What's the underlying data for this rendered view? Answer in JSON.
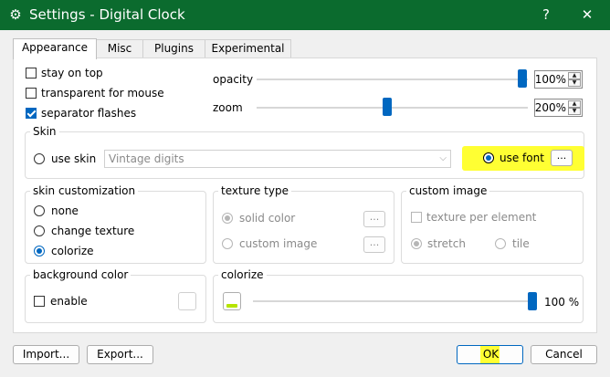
{
  "window": {
    "title": "Settings - Digital Clock",
    "help_glyph": "?",
    "close_glyph": "✕",
    "title_bar_color": "#0b6b2e"
  },
  "tabs": [
    {
      "label": "Appearance",
      "active": true
    },
    {
      "label": "Misc",
      "active": false
    },
    {
      "label": "Plugins",
      "active": false
    },
    {
      "label": "Experimental",
      "active": false
    }
  ],
  "general": {
    "stay_on_top": {
      "label": "stay on top",
      "checked": false
    },
    "transparent_for_mouse": {
      "label": "transparent for mouse",
      "checked": false
    },
    "separator_flashes": {
      "label": "separator flashes",
      "checked": true
    }
  },
  "opacity": {
    "label": "opacity",
    "value": "100%",
    "level_percent": 100
  },
  "zoom": {
    "label": "zoom",
    "value": "200%",
    "level_percent": 49
  },
  "skin": {
    "group_label": "Skin",
    "use_skin_label": "use skin",
    "skin_value": "Vintage digits",
    "use_font_label": "use font",
    "font_button": "...",
    "selected": "use font"
  },
  "skin_customization": {
    "group_label": "skin customization",
    "options": [
      {
        "label": "none",
        "checked": false
      },
      {
        "label": "change texture",
        "checked": false
      },
      {
        "label": "colorize",
        "checked": true
      }
    ]
  },
  "texture_type": {
    "group_label": "texture type",
    "solid_color": "solid color",
    "custom_image": "custom image",
    "button": "..."
  },
  "custom_image": {
    "group_label": "custom image",
    "per_element": "texture per element",
    "stretch": "stretch",
    "tile": "tile"
  },
  "background_color": {
    "group_label": "background color",
    "enable": "enable"
  },
  "colorize": {
    "group_label": "colorize",
    "value": "100 %",
    "level_percent": 100,
    "swatch_color": "#b6e400"
  },
  "buttons": {
    "import": "Import...",
    "export": "Export...",
    "ok": "OK",
    "cancel": "Cancel"
  },
  "accent_color": "#0067c0",
  "highlight_color": "#ffff33"
}
